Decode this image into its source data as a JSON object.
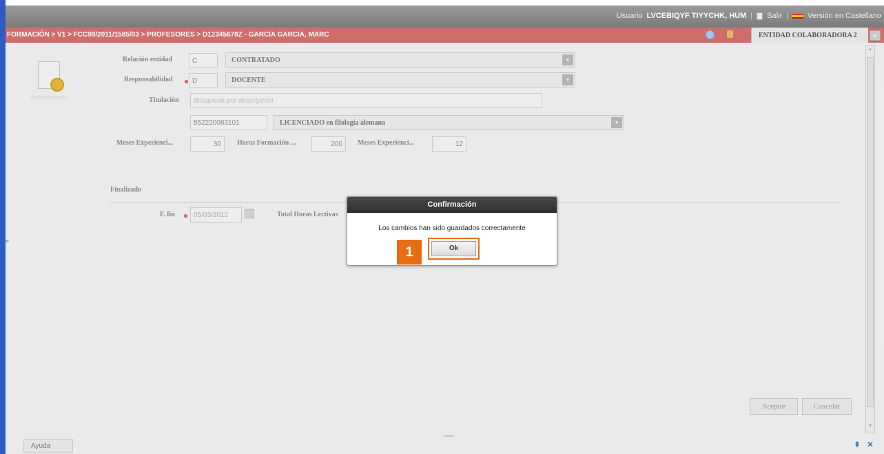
{
  "topbar": {
    "user_label": "Usuario",
    "user_name": "LVCEBIQYF TIYYCHK, HUM",
    "salir": "Salir",
    "language": "Versión en Castellano"
  },
  "breadcrumb": "FORMACIÓN > V1 > FCC99/2011/1585/03 > PROFESORES > D12345678Z - GARCIA GARCIA, MARC",
  "entity_tab": "ENTIDAD COLABORADORA 2",
  "left_panel": {
    "doc_label": "Gestión documental"
  },
  "form": {
    "relacion": {
      "label": "Relación entidad",
      "code": "C",
      "value": "CONTRATADO"
    },
    "responsabilidad": {
      "label": "Responsabilidad",
      "code": "D",
      "value": "DOCENTE"
    },
    "titulacion": {
      "label": "Titulación",
      "placeholder": "Búsqueda por descripción",
      "code": "552220083101",
      "value": "LICENCIADO en filología alemana"
    },
    "meses_exp1": {
      "label": "Meses Experienci...",
      "value": "30"
    },
    "horas_form": {
      "label": "Horas Formación ...",
      "value": "200"
    },
    "meses_exp2": {
      "label": "Meses Experienci...",
      "value": "12"
    },
    "section_finalizado": "Finalizado",
    "f_fin": {
      "label": "F. fin",
      "value": "05/03/2012"
    },
    "total_horas": {
      "label": "Total Horas Lectivas"
    }
  },
  "buttons": {
    "aceptar": "Aceptar",
    "cancelar": "Cancelar",
    "ayuda": "Ayuda"
  },
  "dialog": {
    "title": "Confirmación",
    "message": "Los cambios han sido guardados correctamente",
    "ok": "Ok",
    "step_badge": "1"
  },
  "colors": {
    "breadcrumb_bg": "#cf6d6d",
    "highlight": "#e76d14",
    "topbar_bg": "#8a8a8a"
  }
}
